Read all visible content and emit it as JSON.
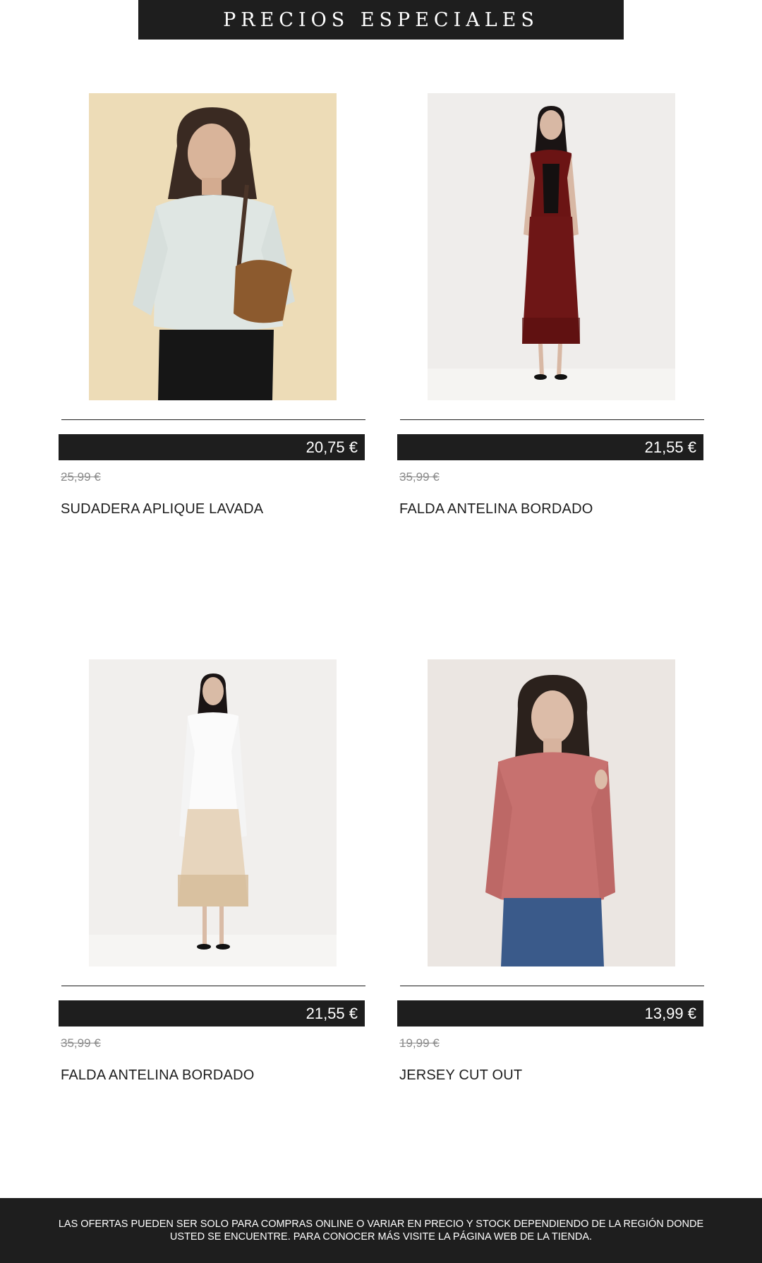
{
  "banner": {
    "title": "PRECIOS ESPECIALES"
  },
  "products": [
    {
      "price": "20,75 €",
      "old_price": "25,99 €",
      "name": "SUDADERA APLIQUE LAVADA",
      "image": "model-light-grey-sweatshirt-brown-bag"
    },
    {
      "price": "21,55 €",
      "old_price": "35,99 €",
      "name": "FALDA ANTELINA BORDADO",
      "image": "model-burgundy-vest-and-skirt"
    },
    {
      "price": "21,55 €",
      "old_price": "35,99 €",
      "name": "FALDA ANTELINA BORDADO",
      "image": "model-white-shirt-beige-skirt"
    },
    {
      "price": "13,99 €",
      "old_price": "19,99 €",
      "name": "JERSEY CUT OUT",
      "image": "model-pink-knit-jersey-jeans"
    }
  ],
  "footer": {
    "disclaimer": "LAS OFERTAS PUEDEN SER SOLO PARA COMPRAS ONLINE O VARIAR EN PRECIO Y STOCK DEPENDIENDO DE LA REGIÓN DONDE USTED SE ENCUENTRE. PARA CONOCER MÁS VISITE LA PÁGINA WEB DE LA TIENDA."
  },
  "colors": {
    "dark": "#1e1e1e",
    "old_price_grey": "#8a8a8a",
    "background": "#ffffff"
  }
}
